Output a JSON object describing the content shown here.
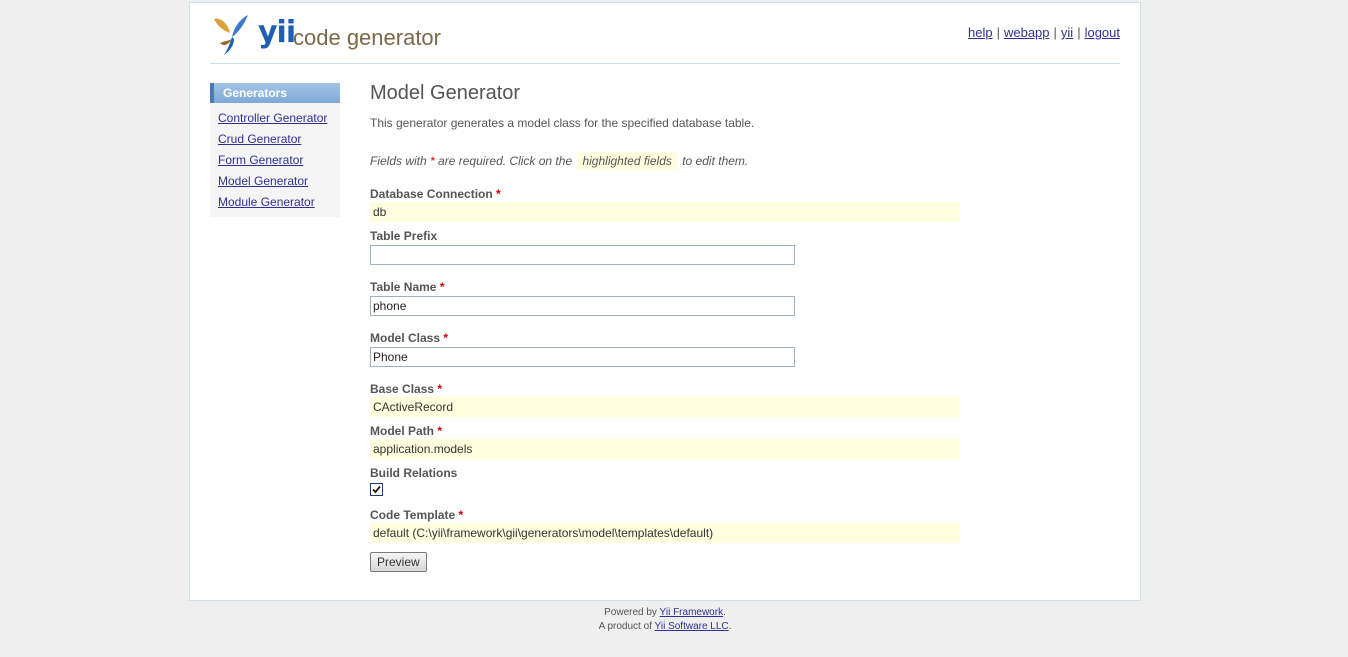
{
  "header": {
    "logo_yii": "yii",
    "logo_text": "code generator",
    "nav": [
      {
        "label": "help"
      },
      {
        "label": "webapp"
      },
      {
        "label": "yii"
      },
      {
        "label": "logout"
      }
    ]
  },
  "sidebar": {
    "title": "Generators",
    "items": [
      {
        "label": "Controller Generator"
      },
      {
        "label": "Crud Generator"
      },
      {
        "label": "Form Generator"
      },
      {
        "label": "Model Generator"
      },
      {
        "label": "Module Generator"
      }
    ]
  },
  "main": {
    "title": "Model Generator",
    "description": "This generator generates a model class for the specified database table.",
    "note_prefix": "Fields with",
    "note_star": "*",
    "note_mid": "are required. Click on the",
    "note_highlight": "highlighted fields",
    "note_suffix": "to edit them.",
    "required_mark": "*",
    "fields": {
      "db_connection": {
        "label": "Database Connection",
        "value": "db"
      },
      "table_prefix": {
        "label": "Table Prefix",
        "value": ""
      },
      "table_name": {
        "label": "Table Name",
        "value": "phone"
      },
      "model_class": {
        "label": "Model Class",
        "value": "Phone"
      },
      "base_class": {
        "label": "Base Class",
        "value": "CActiveRecord"
      },
      "model_path": {
        "label": "Model Path",
        "value": "application.models"
      },
      "build_relations": {
        "label": "Build Relations",
        "checked": true
      },
      "code_template": {
        "label": "Code Template",
        "value": "default (C:\\yii\\framework\\gii\\generators\\model\\templates\\default)"
      }
    },
    "preview_label": "Preview"
  },
  "footer": {
    "powered_prefix": "Powered by",
    "powered_link": "Yii Framework",
    "powered_suffix": ".",
    "product_prefix": "A product of",
    "product_link": "Yii Software LLC",
    "product_suffix": "."
  },
  "colors": {
    "highlight": "#ffffe0",
    "link": "#2e3192",
    "required": "#cc0000",
    "logo_blue": "#1e5fb3"
  }
}
